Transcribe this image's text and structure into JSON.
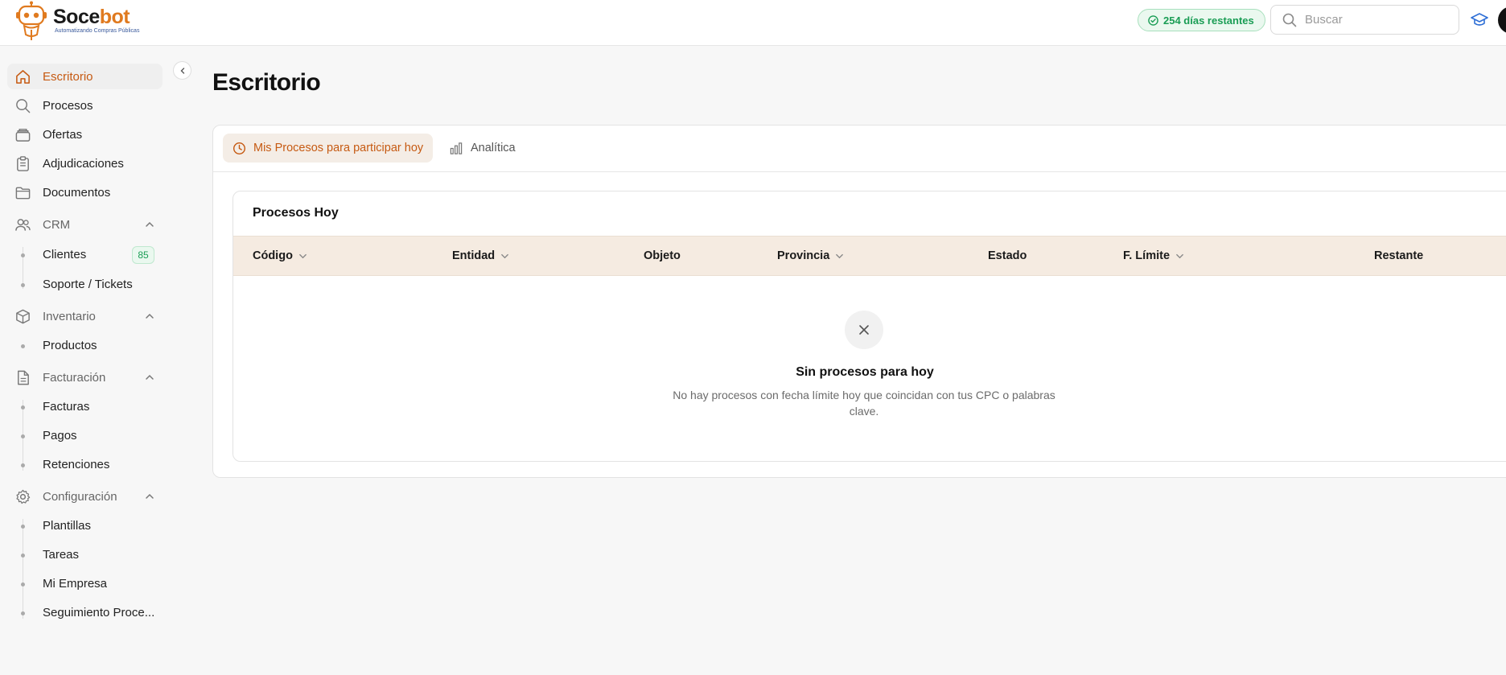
{
  "brand": {
    "name_main": "Soce",
    "name_accent": "bot",
    "tagline": "Automatizando Compras Públicas",
    "accent_color": "#e07a1f"
  },
  "header": {
    "days_remaining": "254 días restantes",
    "search_placeholder": "Buscar"
  },
  "sidebar": {
    "items": [
      {
        "label": "Escritorio",
        "icon": "home-icon",
        "active": true
      },
      {
        "label": "Procesos",
        "icon": "search-icon"
      },
      {
        "label": "Ofertas",
        "icon": "inbox-stack-icon"
      },
      {
        "label": "Adjudicaciones",
        "icon": "clipboard-icon"
      },
      {
        "label": "Documentos",
        "icon": "folder-icon"
      }
    ],
    "groups": [
      {
        "label": "CRM",
        "icon": "users-icon",
        "children": [
          {
            "label": "Clientes",
            "count": "85"
          },
          {
            "label": "Soporte / Tickets"
          }
        ]
      },
      {
        "label": "Inventario",
        "icon": "cube-icon",
        "children": [
          {
            "label": "Productos"
          }
        ]
      },
      {
        "label": "Facturación",
        "icon": "document-icon",
        "children": [
          {
            "label": "Facturas"
          },
          {
            "label": "Pagos"
          },
          {
            "label": "Retenciones"
          }
        ]
      },
      {
        "label": "Configuración",
        "icon": "gear-icon",
        "children": [
          {
            "label": "Plantillas"
          },
          {
            "label": "Tareas"
          },
          {
            "label": "Mi Empresa"
          },
          {
            "label": "Seguimiento Proce..."
          }
        ]
      }
    ]
  },
  "main": {
    "title": "Escritorio",
    "tabs": [
      {
        "label": "Mis Procesos para participar hoy",
        "active": true
      },
      {
        "label": "Analítica"
      }
    ],
    "table": {
      "title": "Procesos Hoy",
      "columns": [
        "Código",
        "Entidad",
        "Objeto",
        "Provincia",
        "Estado",
        "F. Límite",
        "Restante"
      ],
      "empty_title": "Sin procesos para hoy",
      "empty_desc": "No hay procesos con fecha límite hoy que coincidan con tus CPC o palabras clave."
    }
  },
  "colors": {
    "active": "#c65a12",
    "success": "#1a9d55",
    "table_header_bg": "#f5ebe1"
  }
}
